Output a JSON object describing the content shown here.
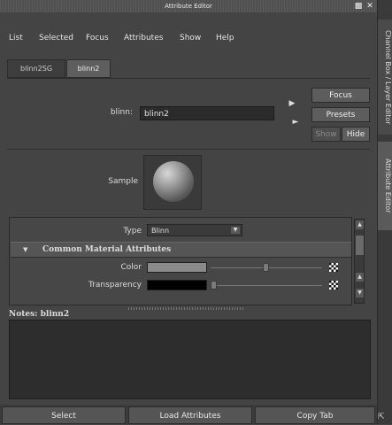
{
  "window": {
    "title": "Attribute Editor",
    "float_icon": "float-window-icon",
    "close_icon": "close-icon"
  },
  "menu": [
    "List",
    "Selected",
    "Focus",
    "Attributes",
    "Show",
    "Help"
  ],
  "tabs": [
    {
      "label": "blinn2SG",
      "active": false
    },
    {
      "label": "blinn2",
      "active": true
    }
  ],
  "node": {
    "label": "blinn:",
    "value": "blinn2"
  },
  "buttons": {
    "focus": "Focus",
    "presets": "Presets",
    "show": "Show",
    "hide": "Hide"
  },
  "sample": {
    "label": "Sample"
  },
  "type": {
    "label": "Type",
    "value": "Blinn"
  },
  "section": {
    "title": "Common Material Attributes"
  },
  "attributes": [
    {
      "label": "Color",
      "swatch_color": "#8a8a8a",
      "slider": 0.5
    },
    {
      "label": "Transparency",
      "swatch_color": "#000000",
      "slider": 0.0
    }
  ],
  "notes": {
    "label": "Notes:  blinn2"
  },
  "bottom_buttons": {
    "select": "Select",
    "load": "Load Attributes",
    "copy": "Copy Tab"
  },
  "side_tabs": {
    "channel_box": "Channel Box / Layer Editor",
    "attribute_editor": "Attribute Editor"
  }
}
